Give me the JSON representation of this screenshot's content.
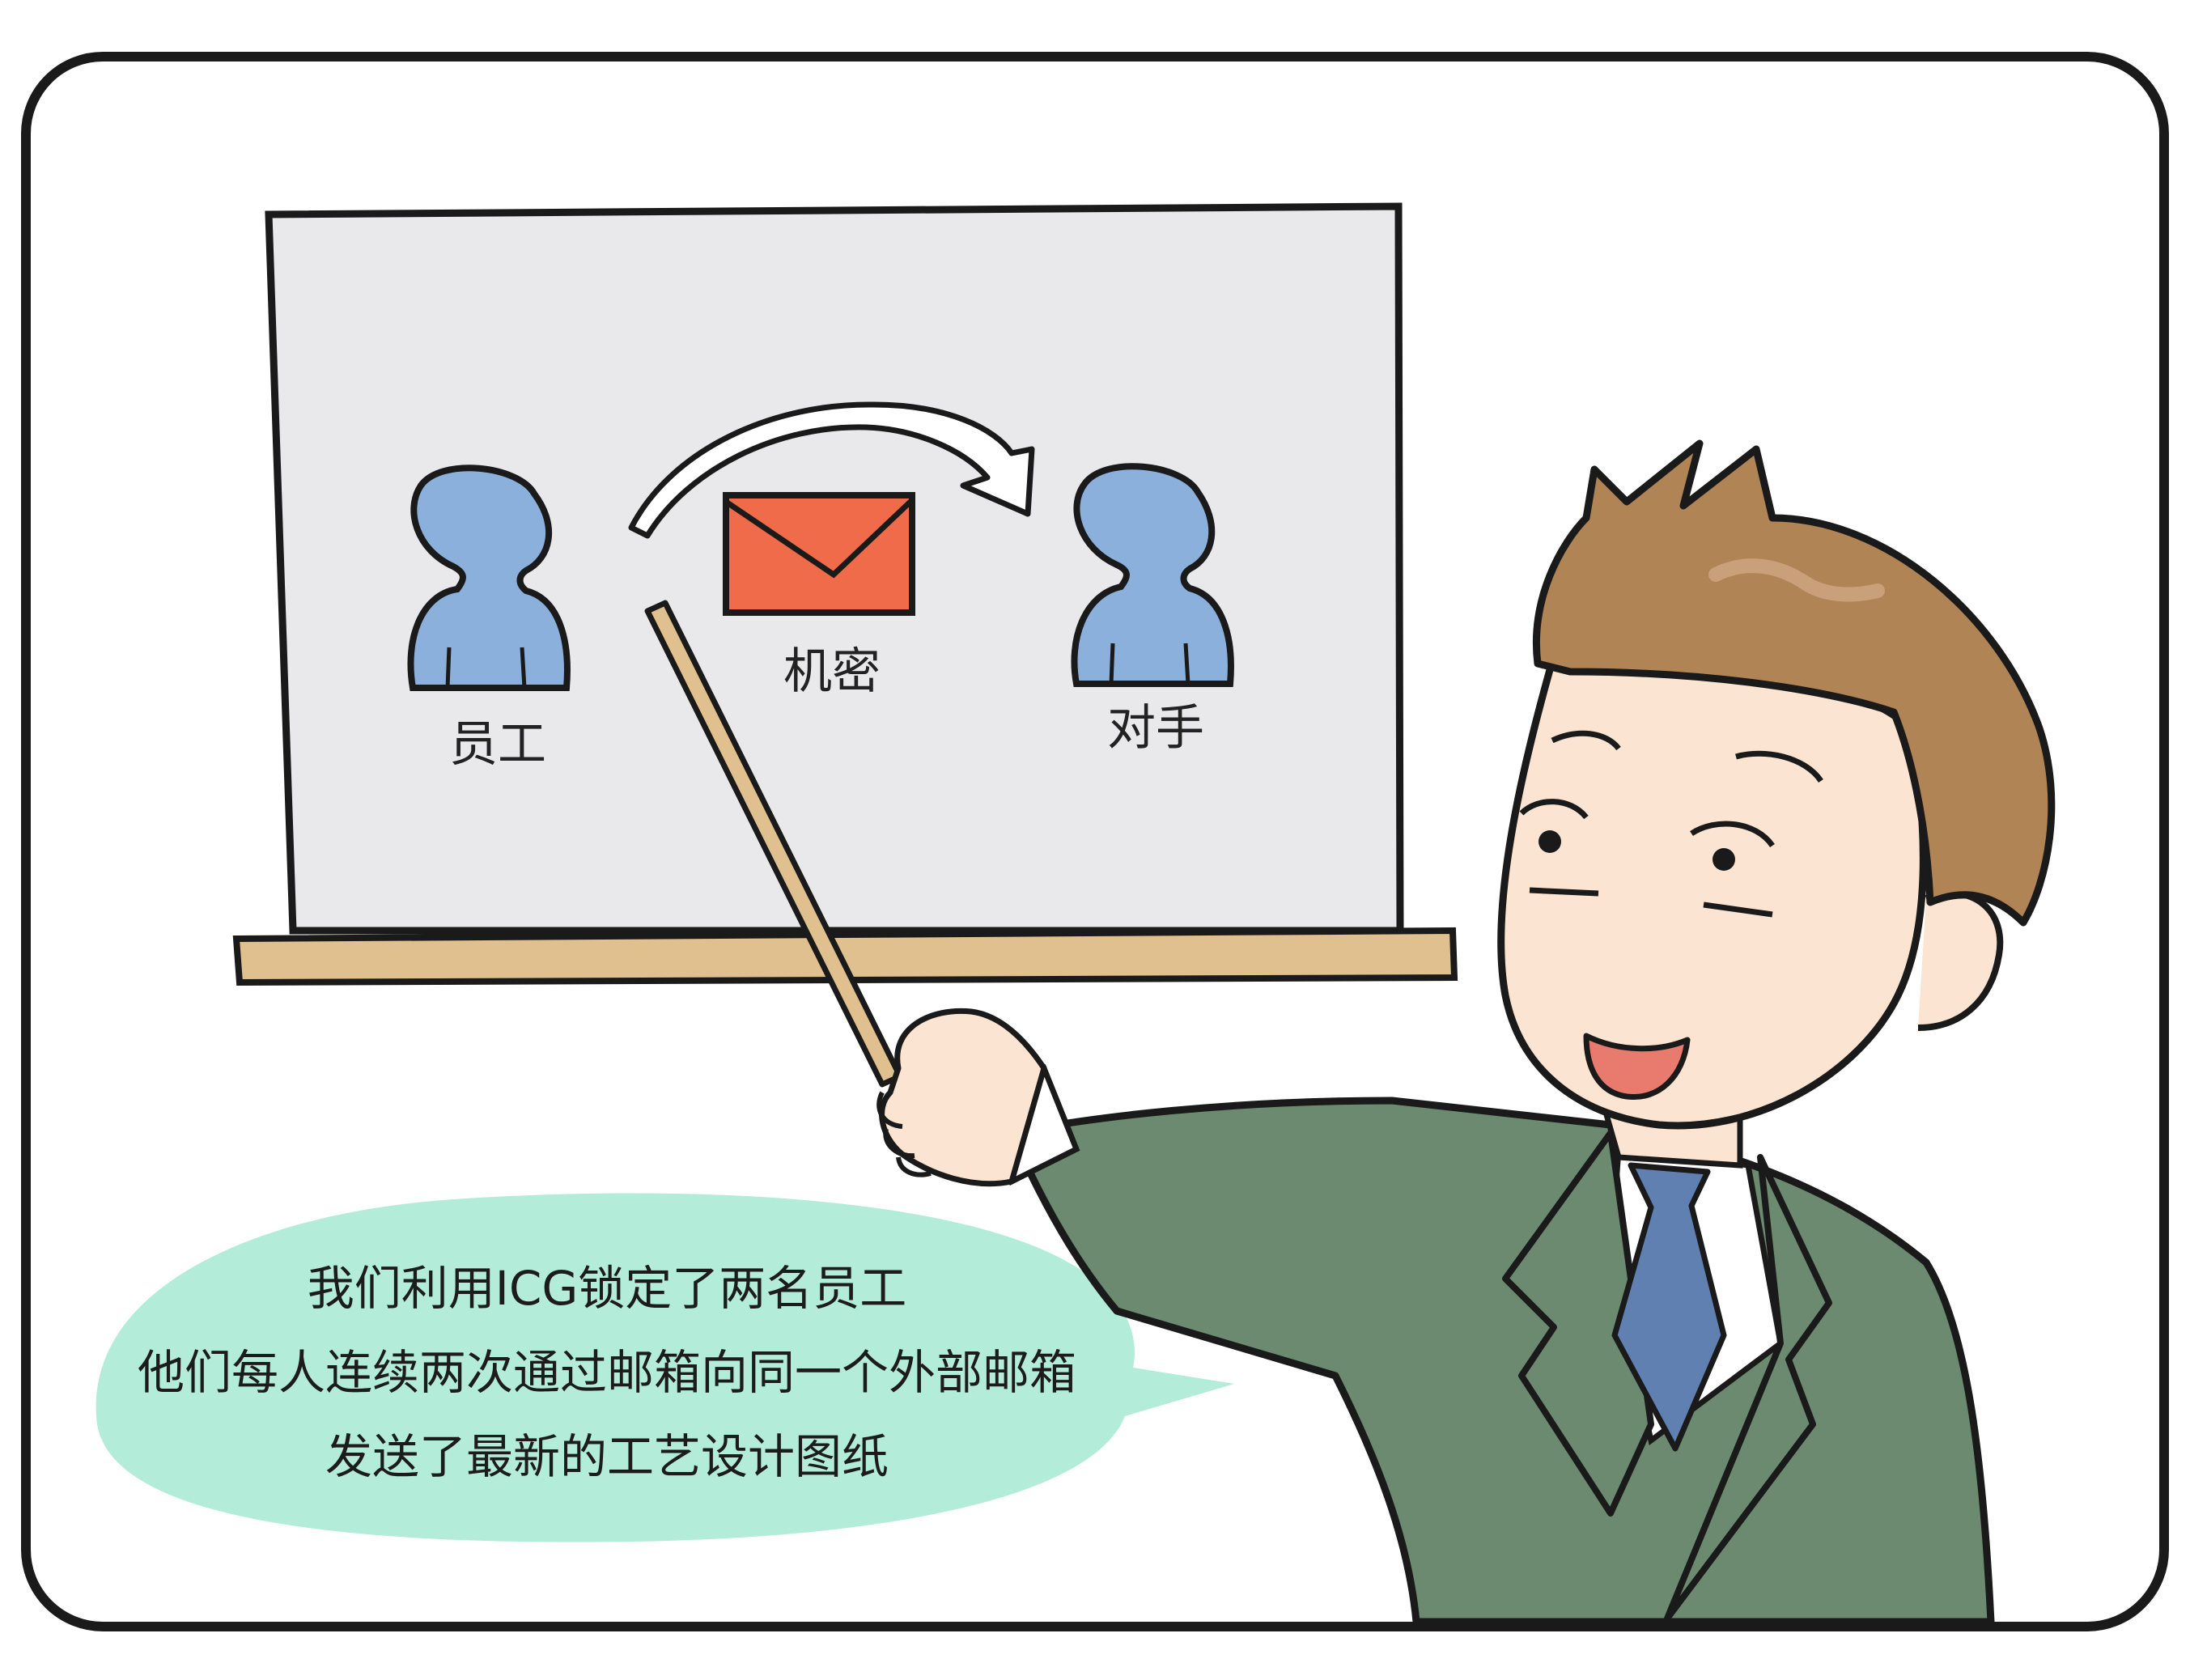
{
  "board": {
    "employee_label": "员工",
    "secret_label": "机密",
    "rival_label": "对手"
  },
  "speech": {
    "line1": "我们利用ICG锁定了两名员工",
    "line2": "他们每人连续两次通过邮箱向同一个外部邮箱",
    "line3": "发送了最新的工艺设计图纸"
  },
  "colors": {
    "board_fill": "#e9e9ec",
    "ledge": "#dfc08e",
    "person": "#8cb0dc",
    "envelope": "#f06b4a",
    "hair": "#b08455",
    "skin": "#fbe4d2",
    "suit": "#6b8a6f",
    "tie": "#5f80b0",
    "bubble": "#b3ecd9"
  },
  "icons": [
    "person-icon",
    "envelope-icon",
    "curved-arrow-icon",
    "pointer-stick-icon"
  ]
}
